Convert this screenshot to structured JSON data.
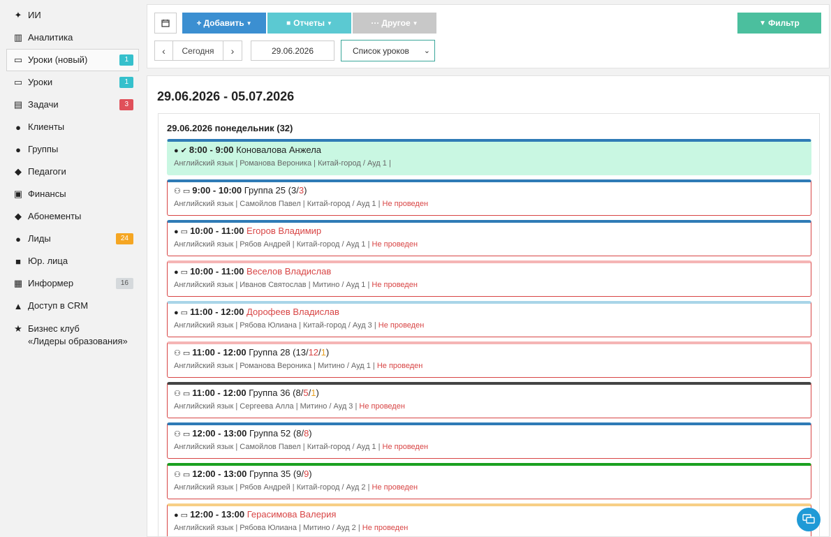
{
  "sidebar": {
    "items": [
      {
        "key": "ai",
        "icon": "sparkles-icon",
        "glyph": "✦",
        "label": "ИИ"
      },
      {
        "key": "analytics",
        "icon": "map-icon",
        "glyph": "▥",
        "label": "Аналитика"
      },
      {
        "key": "lessons-new",
        "icon": "calendar-icon",
        "glyph": "▭",
        "label": "Уроки (новый)",
        "badge": "1",
        "badge_color": "#35c0cc",
        "active": true
      },
      {
        "key": "lessons",
        "icon": "calendar-icon",
        "glyph": "▭",
        "label": "Уроки",
        "badge": "1",
        "badge_color": "#35c0cc"
      },
      {
        "key": "tasks",
        "icon": "clipboard-icon",
        "glyph": "▤",
        "label": "Задачи",
        "badge": "3",
        "badge_color": "#e0505a"
      },
      {
        "key": "clients",
        "icon": "user-icon",
        "glyph": "●",
        "label": "Клиенты"
      },
      {
        "key": "groups",
        "icon": "users-icon",
        "glyph": "●",
        "label": "Группы"
      },
      {
        "key": "teachers",
        "icon": "graduation-cap-icon",
        "glyph": "◆",
        "label": "Педагоги"
      },
      {
        "key": "finance",
        "icon": "money-icon",
        "glyph": "▣",
        "label": "Финансы"
      },
      {
        "key": "subscriptions",
        "icon": "tag-icon",
        "glyph": "◆",
        "label": "Абонементы"
      },
      {
        "key": "leads",
        "icon": "add-user-icon",
        "glyph": "●",
        "label": "Лиды",
        "badge": "24",
        "badge_color": "#f5a623"
      },
      {
        "key": "legal",
        "icon": "briefcase-icon",
        "glyph": "■",
        "label": "Юр. лица"
      },
      {
        "key": "informer",
        "icon": "newspaper-icon",
        "glyph": "▦",
        "label": "Информер",
        "badge": "16",
        "badge_color": "#d5d9dc",
        "badge_text_color": "#555"
      },
      {
        "key": "crm-access",
        "icon": "lock-icon",
        "glyph": "▲",
        "label": "Доступ в CRM"
      },
      {
        "key": "business-club",
        "icon": "star-icon",
        "glyph": "★",
        "label": "Бизнес клуб",
        "label2": "«Лидеры образования»"
      }
    ]
  },
  "toolbar": {
    "add_label": "Добавить",
    "reports_label": "Отчеты",
    "other_label": "Другое",
    "filter_label": "Фильтр",
    "today_label": "Сегодня",
    "date_value": "29.06.2026",
    "view_value": "Список уроков"
  },
  "main": {
    "range_title": "29.06.2026 - 05.07.2026",
    "day_title": "29.06.2026 понедельник (32)"
  },
  "lessons": [
    {
      "kind": "single",
      "done": true,
      "check": true,
      "color": "#2f7bb6",
      "time": "8:00 - 9:00",
      "name": "Коновалова Анжела",
      "name_red": false,
      "subject": "Английский язык",
      "teacher": "Романова Вероника",
      "room": "Китай-город / Ауд 1",
      "status": ""
    },
    {
      "kind": "group",
      "color": "#2f7bb6",
      "time": "9:00 - 10:00",
      "name": "Группа 25",
      "counts": [
        "3",
        "3"
      ],
      "count_colors": [
        "",
        "red"
      ],
      "subject": "Английский язык",
      "teacher": "Самойлов Павел",
      "room": "Китай-город / Ауд 1",
      "status": "Не проведен"
    },
    {
      "kind": "single",
      "color": "#2f7bb6",
      "time": "10:00 - 11:00",
      "name": "Егоров Владимир",
      "name_red": true,
      "subject": "Английский язык",
      "teacher": "Рябов Андрей",
      "room": "Китай-город / Ауд 1",
      "status": "Не проведен"
    },
    {
      "kind": "single",
      "color": "#f5b5b5",
      "time": "10:00 - 11:00",
      "name": "Веселов Владислав",
      "name_red": true,
      "subject": "Английский язык",
      "teacher": "Иванов Святослав",
      "room": "Митино / Ауд 1",
      "status": "Не проведен"
    },
    {
      "kind": "single",
      "color": "#a9d5e8",
      "time": "11:00 - 12:00",
      "name": "Дорофеев Владислав",
      "name_red": true,
      "subject": "Английский язык",
      "teacher": "Рябова Юлиана",
      "room": "Китай-город / Ауд 3",
      "status": "Не проведен"
    },
    {
      "kind": "group",
      "color": "#f5b5b5",
      "time": "11:00 - 12:00",
      "name": "Группа 28",
      "counts": [
        "13",
        "12",
        "1"
      ],
      "count_colors": [
        "",
        "red",
        "yel"
      ],
      "subject": "Английский язык",
      "teacher": "Романова Вероника",
      "room": "Митино / Ауд 1",
      "status": "Не проведен"
    },
    {
      "kind": "group",
      "color": "#444444",
      "time": "11:00 - 12:00",
      "name": "Группа 36",
      "counts": [
        "8",
        "5",
        "1"
      ],
      "count_colors": [
        "",
        "red",
        "yel"
      ],
      "subject": "Английский язык",
      "teacher": "Сергеева Алла",
      "room": "Митино / Ауд 3",
      "status": "Не проведен"
    },
    {
      "kind": "group",
      "color": "#2f7bb6",
      "time": "12:00 - 13:00",
      "name": "Группа 52",
      "counts": [
        "8",
        "8"
      ],
      "count_colors": [
        "",
        "red"
      ],
      "subject": "Английский язык",
      "teacher": "Самойлов Павел",
      "room": "Китай-город / Ауд 1",
      "status": "Не проведен"
    },
    {
      "kind": "group",
      "color": "#1aa020",
      "time": "12:00 - 13:00",
      "name": "Группа 35",
      "counts": [
        "9",
        "9"
      ],
      "count_colors": [
        "",
        "red"
      ],
      "subject": "Английский язык",
      "teacher": "Рябов Андрей",
      "room": "Китай-город / Ауд 2",
      "status": "Не проведен"
    },
    {
      "kind": "single",
      "color": "#f7cf86",
      "time": "12:00 - 13:00",
      "name": "Герасимова Валерия",
      "name_red": true,
      "subject": "Английский язык",
      "teacher": "Рябова Юлиана",
      "room": "Митино / Ауд 2",
      "status": "Не проведен"
    }
  ]
}
